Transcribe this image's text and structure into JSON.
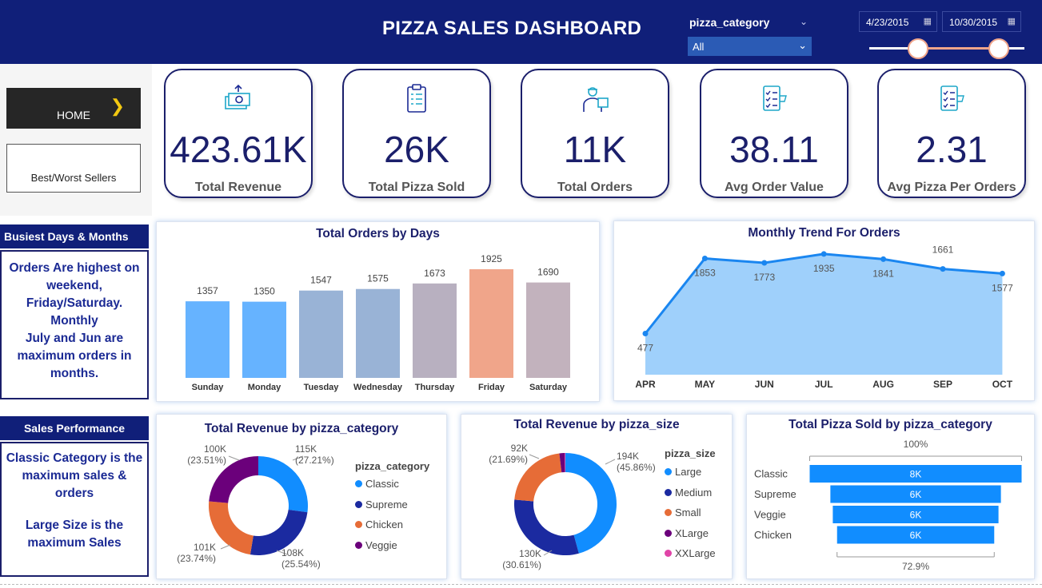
{
  "header": {
    "title": "PIZZA SALES DASHBOARD",
    "slicer_label": "pizza_category",
    "slicer_value": "All",
    "date_start": "4/23/2015",
    "date_end": "10/30/2015",
    "bg_color": "#101f79"
  },
  "nav": {
    "home_label": "HOME",
    "bestworst_label": "Best/Worst Sellers"
  },
  "kpis": [
    {
      "value": "423.61K",
      "label": "Total Revenue",
      "icon": "money-icon"
    },
    {
      "value": "26K",
      "label": "Total Pizza Sold",
      "icon": "clipboard-icon"
    },
    {
      "value": "11K",
      "label": "Total Orders",
      "icon": "delivery-person-icon"
    },
    {
      "value": "38.11",
      "label": "Avg Order Value",
      "icon": "checklist-icon"
    },
    {
      "value": "2.31",
      "label": "Avg Pizza Per Orders",
      "icon": "checklist-icon"
    }
  ],
  "insights": {
    "busiest_title": "Busiest Days & Months",
    "busiest_lines": [
      "Orders Are highest on",
      "weekend,",
      "Friday/Saturday.",
      "Monthly",
      "July and Jun are",
      "maximum orders in",
      "months."
    ],
    "sales_title": "Sales Performance",
    "sales_lines": [
      "Classic Category is the",
      "maximum sales &",
      "orders",
      "",
      "Large Size is the",
      "maximum Sales"
    ]
  },
  "chart_data": [
    {
      "type": "bar",
      "title": "Total Orders by Days",
      "categories": [
        "Sunday",
        "Monday",
        "Tuesday",
        "Wednesday",
        "Thursday",
        "Friday",
        "Saturday"
      ],
      "values": [
        1357,
        1350,
        1547,
        1575,
        1673,
        1925,
        1690
      ],
      "colors": [
        "#66b3ff",
        "#66b3ff",
        "#99b3d6",
        "#99b3d6",
        "#b8b0c0",
        "#f0a58a",
        "#c2b2bd"
      ],
      "grid": false
    },
    {
      "type": "area",
      "title": "Monthly Trend For Orders",
      "categories": [
        "APR",
        "MAY",
        "JUN",
        "JUL",
        "AUG",
        "SEP",
        "OCT"
      ],
      "values": [
        477,
        1853,
        1773,
        1935,
        1841,
        1661,
        1577
      ],
      "color": "#1a86f0",
      "fill": "#9fd0fb"
    },
    {
      "type": "pie",
      "title": "Total Revenue by pizza_category",
      "legend_title": "pizza_category",
      "slices": [
        {
          "name": "Classic",
          "value": 115,
          "label": "115K",
          "pct": "(27.21%)",
          "color": "#118dff"
        },
        {
          "name": "Supreme",
          "value": 108,
          "label": "108K",
          "pct": "(25.54%)",
          "color": "#1b2aa0"
        },
        {
          "name": "Chicken",
          "value": 101,
          "label": "101K",
          "pct": "(23.74%)",
          "color": "#e66c37"
        },
        {
          "name": "Veggie",
          "value": 100,
          "label": "100K",
          "pct": "(23.51%)",
          "color": "#6b007b"
        }
      ]
    },
    {
      "type": "pie",
      "title": "Total Revenue by pizza_size",
      "legend_title": "pizza_size",
      "slices": [
        {
          "name": "Large",
          "value": 194,
          "label": "194K",
          "pct": "(45.86%)",
          "color": "#118dff"
        },
        {
          "name": "Medium",
          "value": 130,
          "label": "130K",
          "pct": "(30.61%)",
          "color": "#1b2aa0"
        },
        {
          "name": "Small",
          "value": 92,
          "label": "92K",
          "pct": "(21.69%)",
          "color": "#e66c37"
        },
        {
          "name": "XLarge",
          "value": 7,
          "label": "",
          "pct": "",
          "color": "#6b007b"
        },
        {
          "name": "XXLarge",
          "value": 1,
          "label": "",
          "pct": "",
          "color": "#e044a7"
        }
      ]
    },
    {
      "type": "bar",
      "subtype": "funnel",
      "title": "Total Pizza Sold by pizza_category",
      "categories": [
        "Classic",
        "Supreme",
        "Veggie",
        "Chicken"
      ],
      "values": [
        14.9,
        11.99,
        11.65,
        11.05
      ],
      "labels": [
        "8K",
        "6K",
        "6K",
        "6K"
      ],
      "top_pct": "100%",
      "bottom_pct": "72.9%",
      "color": "#118dff"
    }
  ]
}
